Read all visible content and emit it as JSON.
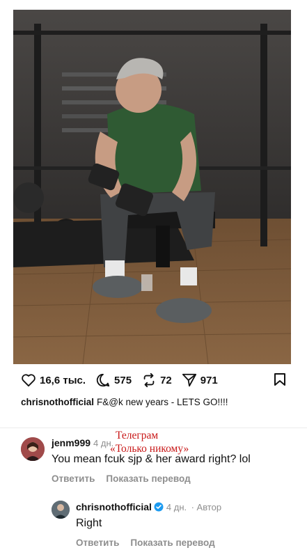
{
  "post": {
    "likes": "16,6 тыс.",
    "comments": "575",
    "reposts": "72",
    "shares": "971",
    "caption_user": "chrisnothofficial",
    "caption_text": "F&@k new years - LETS GO!!!!"
  },
  "comments": [
    {
      "user": "jenm999",
      "age": "4 дн.",
      "text": "You mean fcuk sjp & her award right? lol",
      "reply_label": "Ответить",
      "translate_label": "Показать перевод"
    },
    {
      "user": "chrisnothofficial",
      "age": "4 дн.",
      "author_badge": "· Автор",
      "text": "Right",
      "reply_label": "Ответить",
      "translate_label": "Показать перевод"
    }
  ],
  "watermark": {
    "line1": "Телеграм",
    "line2": "«Только никому»"
  },
  "colors": {
    "verified": "#1d9bf0",
    "secondary_text": "#8e8e8e",
    "watermark": "#c81818"
  }
}
